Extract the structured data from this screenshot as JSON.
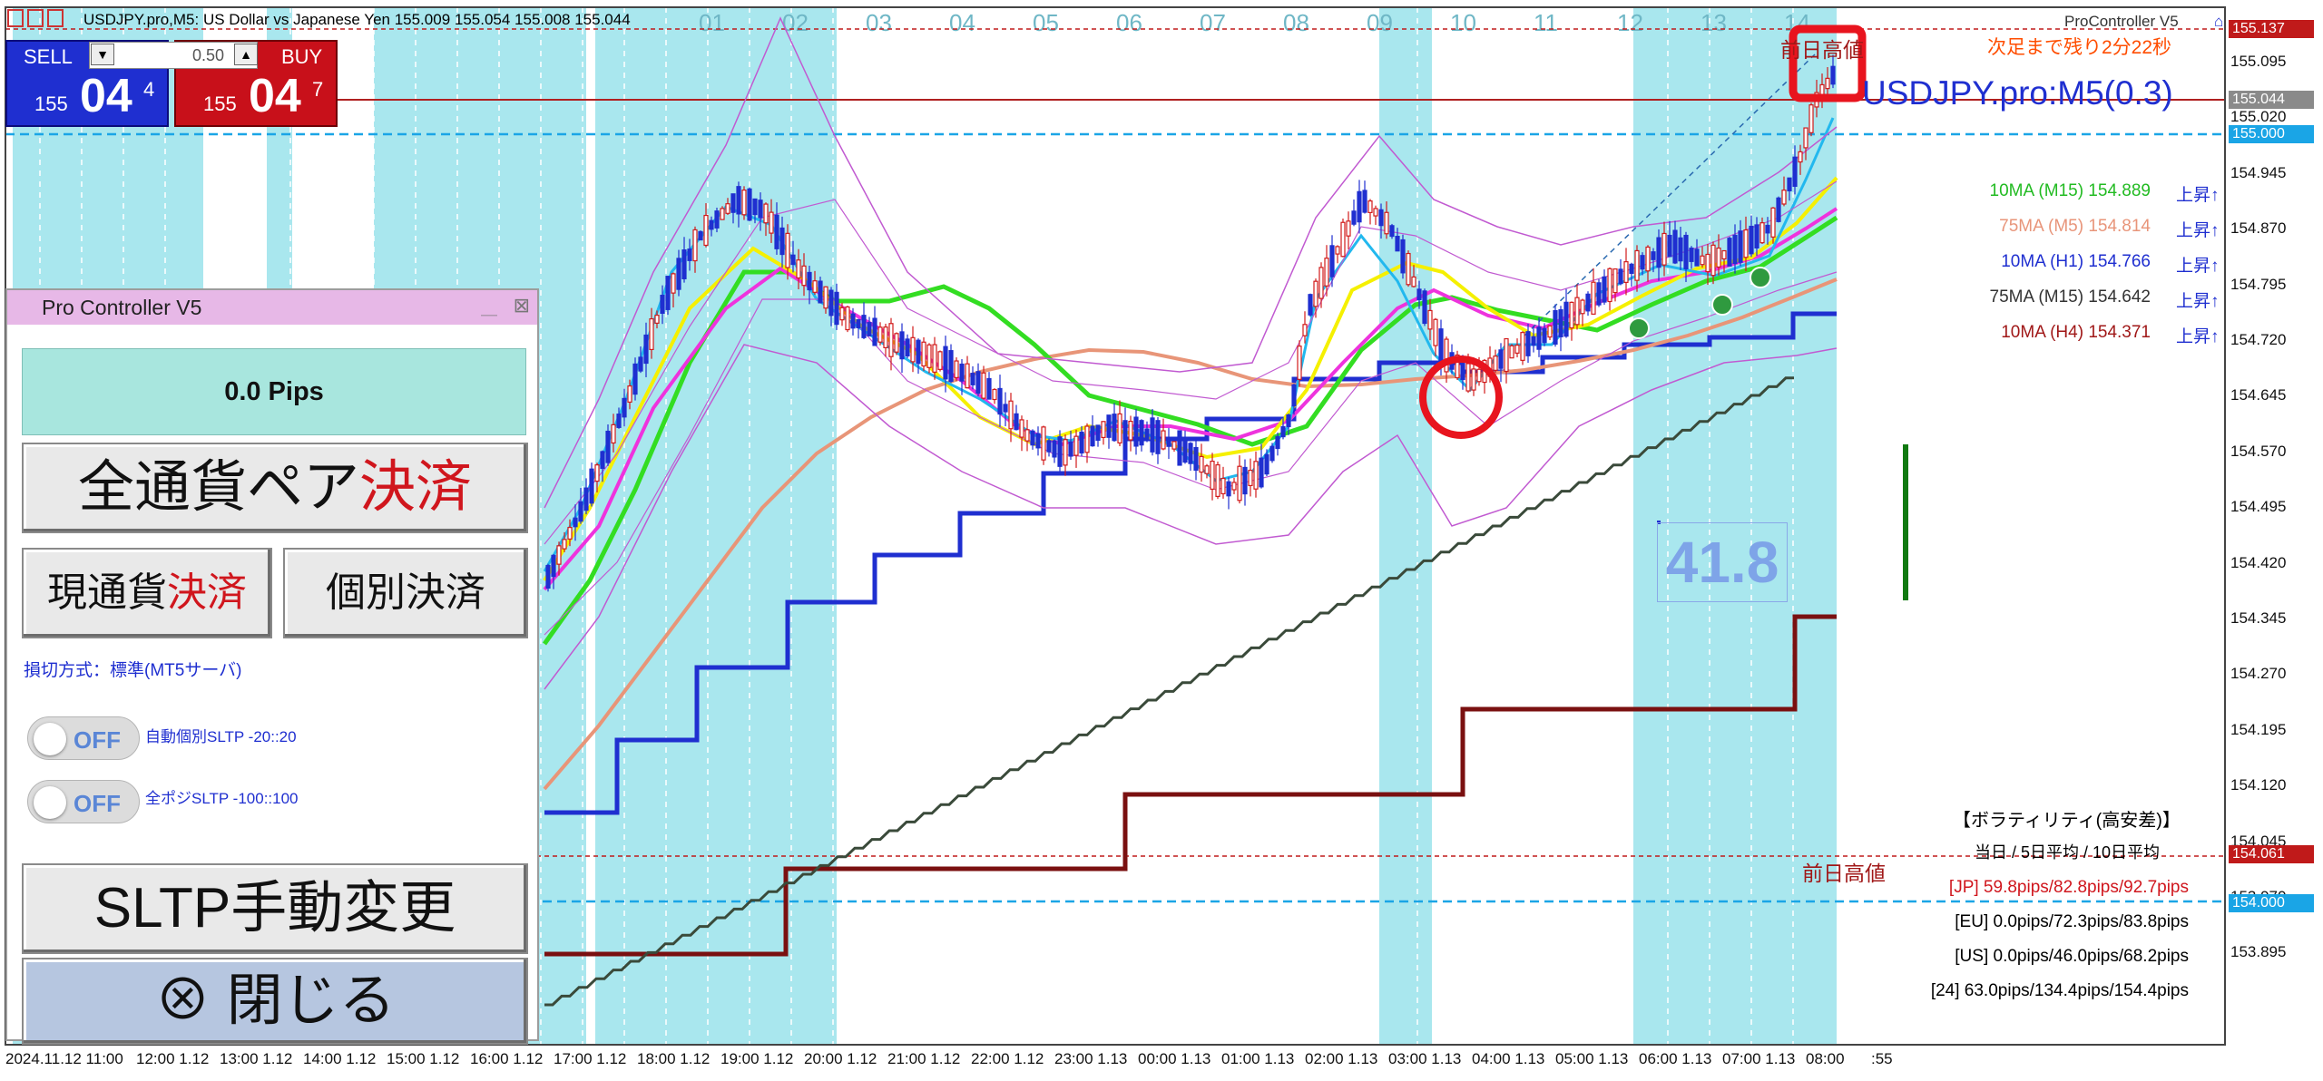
{
  "window": {
    "title": "USDJPY.pro,M5: US Dollar vs Japanese Yen  155.009 155.054 155.008 155.044",
    "top_right_label": "ProController V5"
  },
  "one_click": {
    "sell_label": "SELL",
    "buy_label": "BUY",
    "lot_value": "0.50",
    "sell_small": "155",
    "sell_big": "04",
    "sell_sup": "4",
    "buy_small": "155",
    "buy_big": "04",
    "buy_sup": "7"
  },
  "period_numbers": [
    "01",
    "02",
    "03",
    "04",
    "05",
    "06",
    "07",
    "08",
    "09",
    "10",
    "11",
    "12",
    "13",
    "14"
  ],
  "chart": {
    "symbol_label": "USDJPY.pro:M5(0.3)",
    "countdown": "次足まで残り2分22秒",
    "prev_day_high_top": "前日高値",
    "prev_day_high_bottom": "前日高値",
    "range_value": "41.8",
    "price_labels": [
      "155.095",
      "155.020",
      "154.945",
      "154.870",
      "154.795",
      "154.720",
      "154.645",
      "154.570",
      "154.495",
      "154.420",
      "154.345",
      "154.270",
      "154.195",
      "154.120",
      "154.045",
      "153.970",
      "153.895"
    ],
    "price_boxes": [
      {
        "value": "155.137",
        "color": "#c01a1a"
      },
      {
        "value": "155.044",
        "color": "#8a8a8a"
      },
      {
        "value": "155.000",
        "color": "#1aa5e6"
      },
      {
        "value": "154.061",
        "color": "#c01a1a"
      },
      {
        "value": "154.000",
        "color": "#1aa5e6"
      }
    ],
    "time_labels": [
      "2024.11.12 11:00",
      "12:00 1.12",
      "13:00 1.12",
      "14:00 1.12",
      "15:00 1.12",
      "16:00 1.12",
      "17:00 1.12",
      "18:00 1.12",
      "19:00 1.12",
      "20:00 1.12",
      "21:00 1.12",
      "22:00 1.12",
      "23:00 1.13",
      "00:00 1.13",
      "01:00 1.13",
      "02:00 1.13",
      "03:00 1.13",
      "04:00 1.13",
      "05:00 1.13",
      "06:00 1.13",
      "07:00 1.13",
      "08:00",
      ":55"
    ]
  },
  "ma_list": [
    {
      "name": "10MA (M15) 154.889",
      "trend": "上昇↑",
      "color": "#22bb22"
    },
    {
      "name": "75MA (M5)  154.814",
      "trend": "上昇↑",
      "color": "#e8957a"
    },
    {
      "name": "10MA (H1)  154.766",
      "trend": "上昇↑",
      "color": "#1f2fd0"
    },
    {
      "name": "75MA (M15) 154.642",
      "trend": "上昇↑",
      "color": "#333333"
    },
    {
      "name": "10MA (H4)  154.371",
      "trend": "上昇↑",
      "color": "#a01818"
    }
  ],
  "volatility": {
    "title": "【ボラティリティ(高安差)】",
    "header": "当日 / 5日平均 / 10日平均",
    "rows": [
      {
        "text": "[JP] 59.8pips/82.8pips/92.7pips",
        "color": "#d0161d"
      },
      {
        "text": "[EU]  0.0pips/72.3pips/83.8pips",
        "color": "#000000"
      },
      {
        "text": "[US]  0.0pips/46.0pips/68.2pips",
        "color": "#000000"
      },
      {
        "text": "[24] 63.0pips/134.4pips/154.4pips",
        "color": "#000000"
      }
    ]
  },
  "panel": {
    "title": "Pro Controller V5",
    "pips": "0.0 Pips",
    "close_all_prefix": "全通貨ペア",
    "close_all_suffix": "決済",
    "close_current_prefix": "現通貨",
    "close_current_suffix": "決済",
    "close_individual": "個別決済",
    "sl_method": "損切方式：標準(MT5サーバ)",
    "toggle1_state": "OFF",
    "toggle1_label": "自動個別SLTP -20::20",
    "toggle2_state": "OFF",
    "toggle2_label": "全ポジSLTP -100::100",
    "sltp_change": "SLTP手動変更",
    "close_panel": "⊗ 閉じる"
  }
}
